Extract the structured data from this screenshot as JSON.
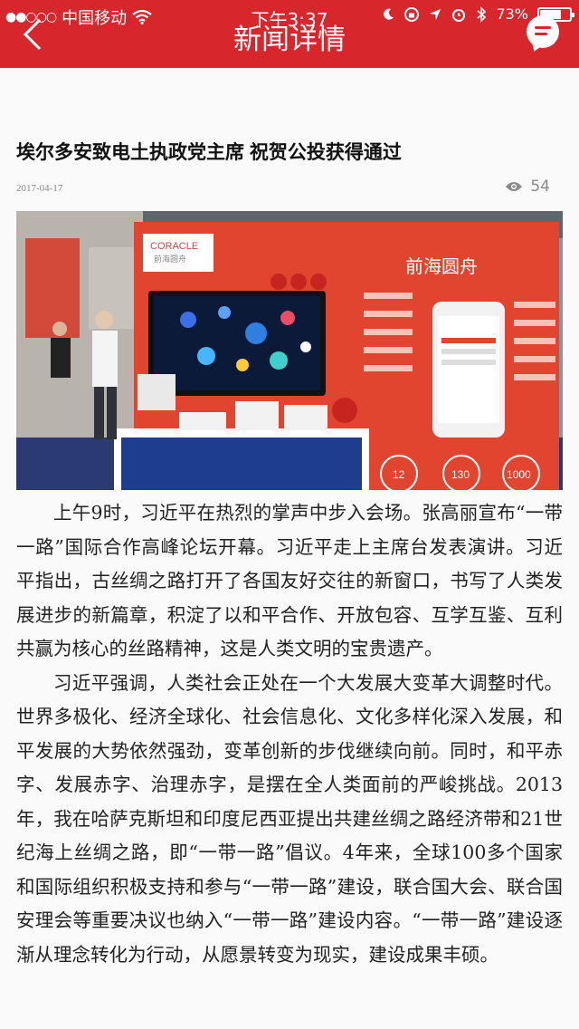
{
  "status_bar": {
    "carrier": "中国移动",
    "time": "下午3:37",
    "battery": "73%",
    "battery_level": 0.73
  },
  "nav": {
    "title": "新闻详情",
    "back_icon": "chevron-left-icon",
    "message_icon": "chat-bubble-icon"
  },
  "article": {
    "title": "埃尔多安致电土执政党主席 祝贺公投获得通过",
    "date": "2017-04-17",
    "views": "54",
    "paragraphs": [
      "上午9时，习近平在热烈的掌声中步入会场。张高丽宣布“一带一路”国际合作高峰论坛开幕。习近平走上主席台发表演讲。习近平指出，古丝绸之路打开了各国友好交往的新窗口，书写了人类发展进步的新篇章，积淀了以和平合作、开放包容、互学互鉴、互利共赢为核心的丝路精神，这是人类文明的宝贵遗产。",
      "习近平强调，人类社会正处在一个大发展大变革大调整时代。世界多极化、经济全球化、社会信息化、文化多样化深入发展，和平发展的大势依然强劲，变革创新的步伐继续向前。同时，和平赤字、发展赤字、治理赤字，是摆在全人类面前的严峻挑战。2013年，我在哈萨克斯坦和印度尼西亚提出共建丝绸之路经济带和21世纪海上丝绸之路，即“一带一路”倡议。4年来，全球100多个国家和国际组织积极支持和参与“一带一路”建设，联合国大会、联合国安理会等重要决议也纳入“一带一路”建设内容。“一带一路”建设逐渐从理念转化为行动，从愿景转变为现实，建设成果丰硕。"
    ]
  },
  "photo": {
    "booth_sign": "前海圆舟",
    "logo_text": "CORACLE",
    "logo_sub": "前海圆舟",
    "stats": [
      "12",
      "130",
      "1000"
    ]
  },
  "colors": {
    "header": "#d8262d",
    "booth": "#e2452f"
  }
}
